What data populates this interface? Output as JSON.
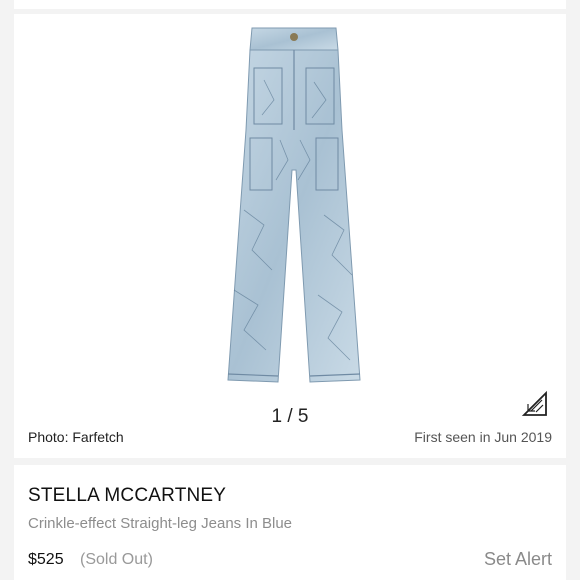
{
  "gallery": {
    "counter": "1 / 5",
    "photo_credit": "Photo: Farfetch",
    "first_seen": "First seen in Jun 2019",
    "expand_icon": "expand-triangle-icon"
  },
  "product": {
    "brand": "STELLA MCCARTNEY",
    "name": "Crinkle-effect Straight-leg Jeans In Blue",
    "price": "$525",
    "status": "(Sold Out)",
    "alert_label": "Set Alert"
  },
  "colors": {
    "denim": "#b9cedd",
    "denim_dark": "#6f8aa3",
    "text": "#111111",
    "muted": "#8d8d8d"
  }
}
